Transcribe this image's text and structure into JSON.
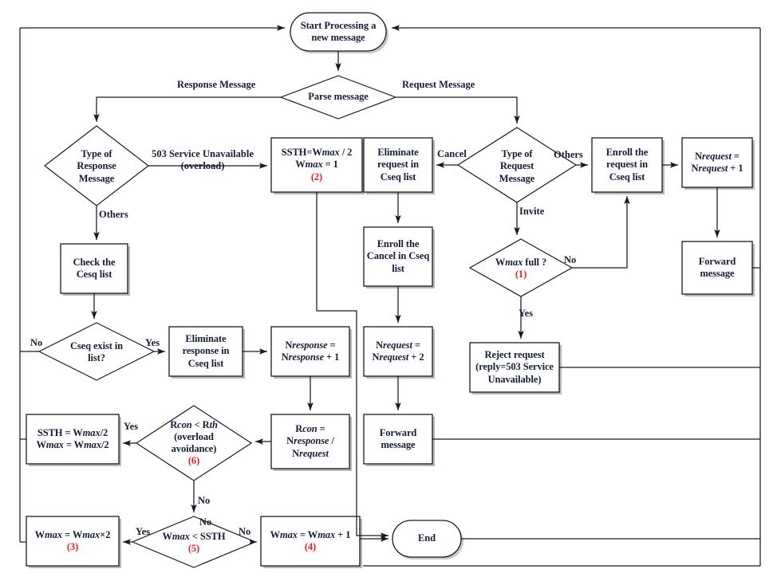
{
  "diagram": {
    "title": "SIP overload control message processing flowchart",
    "colors": {
      "text": "#141d3a",
      "accent_red": "#ee1c25",
      "line": "#000000",
      "shadow": "#b5b5b5",
      "background": "#ffffff"
    },
    "nodes": [
      {
        "id": "start",
        "shape": "terminator",
        "lines": [
          "Start Processing a",
          "new message"
        ]
      },
      {
        "id": "parse",
        "shape": "decision",
        "lines": [
          "Parse message"
        ]
      },
      {
        "id": "type_response",
        "shape": "decision",
        "lines": [
          "Type of",
          "Response",
          "Message"
        ]
      },
      {
        "id": "ssth_overload",
        "shape": "process",
        "lines": [
          "SSTH=Wmax / 2",
          "Wmax = 1"
        ],
        "tag": "(2)"
      },
      {
        "id": "eliminate_req",
        "shape": "process",
        "lines": [
          "Eliminate",
          "request in",
          "Cseq list"
        ]
      },
      {
        "id": "type_request",
        "shape": "decision",
        "lines": [
          "Type of",
          "Request",
          "Message"
        ]
      },
      {
        "id": "enroll_request",
        "shape": "process",
        "lines": [
          "Enroll the",
          "request in",
          "Cseq list"
        ]
      },
      {
        "id": "nrequest_plus1",
        "shape": "process",
        "lines": [
          "Nrequest =",
          "Nrequest + 1"
        ]
      },
      {
        "id": "check_cesq",
        "shape": "process",
        "lines": [
          "Check the",
          "Cesq list"
        ]
      },
      {
        "id": "enroll_cancel",
        "shape": "process",
        "lines": [
          "Enroll the",
          "Cancel in Cseq",
          "list"
        ]
      },
      {
        "id": "wmax_full",
        "shape": "decision",
        "lines": [
          "Wmax full ?"
        ],
        "tag": "(1)"
      },
      {
        "id": "forward_top",
        "shape": "process",
        "lines": [
          "Forward",
          "message"
        ]
      },
      {
        "id": "cseq_exist",
        "shape": "decision",
        "lines": [
          "Cseq exist in",
          "list?"
        ]
      },
      {
        "id": "eliminate_resp",
        "shape": "process",
        "lines": [
          "Eliminate",
          "response in",
          "Cseq list"
        ]
      },
      {
        "id": "nresponse_plus1",
        "shape": "process",
        "lines": [
          "Nresponse =",
          "Nresponse + 1"
        ]
      },
      {
        "id": "nrequest_plus2",
        "shape": "process",
        "lines": [
          "Nrequest =",
          "Nrequest + 2"
        ]
      },
      {
        "id": "reject_request",
        "shape": "process",
        "lines": [
          "Reject request",
          "(reply=503 Service",
          "Unavailable)"
        ]
      },
      {
        "id": "ssth_half",
        "shape": "process",
        "lines": [
          "SSTH = Wmax/2",
          "Wmax = Wmax/2"
        ]
      },
      {
        "id": "rcon_rth",
        "shape": "decision",
        "lines": [
          "Rcon <  Rth",
          "(overload",
          "avoidance)"
        ],
        "tag": "(6)"
      },
      {
        "id": "rcon_calc",
        "shape": "process",
        "lines": [
          "Rcon =",
          "Nresponse /",
          "Nrequest"
        ]
      },
      {
        "id": "forward_mid",
        "shape": "process",
        "lines": [
          "Forward",
          "message"
        ]
      },
      {
        "id": "wmax_times2",
        "shape": "process",
        "lines": [
          "Wmax = Wmax×2"
        ],
        "tag": "(3)"
      },
      {
        "id": "wmax_lt_ssth",
        "shape": "decision",
        "lines": [
          "Wmax < SSTH"
        ],
        "tag": "(5)"
      },
      {
        "id": "wmax_plus1",
        "shape": "process",
        "lines": [
          "Wmax = Wmax + 1"
        ],
        "tag": "(4)"
      },
      {
        "id": "end",
        "shape": "terminator",
        "lines": [
          "End"
        ]
      }
    ],
    "edge_labels": [
      {
        "id": "lbl_response_message",
        "text": "Response Message"
      },
      {
        "id": "lbl_request_message",
        "text": "Request Message"
      },
      {
        "id": "lbl_503",
        "text": "503 Service Unavailable (overload)"
      },
      {
        "id": "lbl_others_response",
        "text": "Others"
      },
      {
        "id": "lbl_cancel",
        "text": "Cancel"
      },
      {
        "id": "lbl_others_request",
        "text": "Others"
      },
      {
        "id": "lbl_invite",
        "text": "Invite"
      },
      {
        "id": "lbl_wmax_full_no",
        "text": "No"
      },
      {
        "id": "lbl_wmax_full_yes",
        "text": "Yes"
      },
      {
        "id": "lbl_cseq_no",
        "text": "No"
      },
      {
        "id": "lbl_cseq_yes",
        "text": "Yes"
      },
      {
        "id": "lbl_rcon_yes",
        "text": "Yes"
      },
      {
        "id": "lbl_rcon_no",
        "text": "No"
      },
      {
        "id": "lbl_ssth_no_top",
        "text": "No"
      },
      {
        "id": "lbl_ssth_yes",
        "text": "Yes"
      },
      {
        "id": "lbl_ssth_no_right",
        "text": "No"
      }
    ]
  }
}
